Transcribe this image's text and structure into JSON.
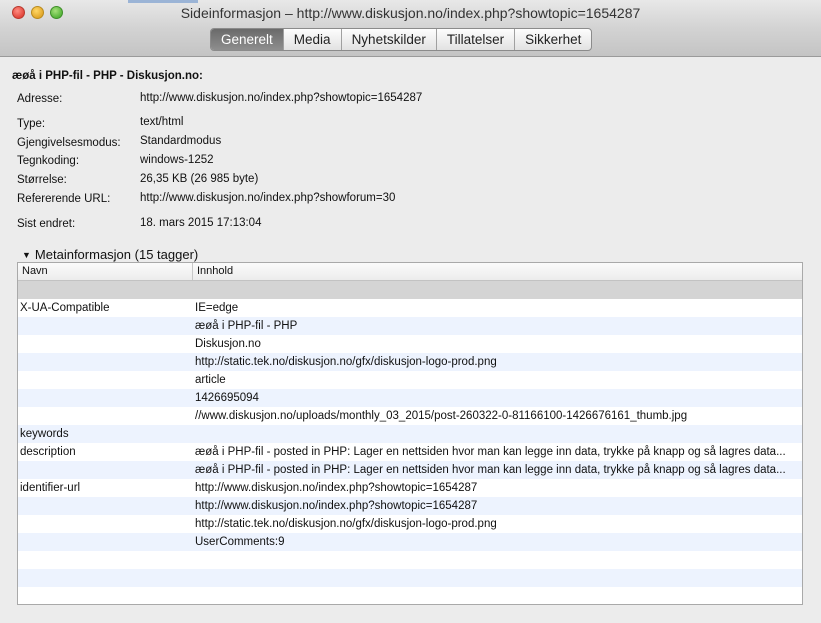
{
  "window": {
    "title": "Sideinformasjon – http://www.diskusjon.no/index.php?showtopic=1654287",
    "tabs": [
      {
        "label": "Generelt",
        "active": true
      },
      {
        "label": "Media",
        "active": false
      },
      {
        "label": "Nyhetskilder",
        "active": false
      },
      {
        "label": "Tillatelser",
        "active": false
      },
      {
        "label": "Sikkerhet",
        "active": false
      }
    ]
  },
  "general": {
    "page_title": "æøå i PHP-fil - PHP - Diskusjon.no:",
    "fields": [
      {
        "label": "Adresse:",
        "value": "http://www.diskusjon.no/index.php?showtopic=1654287"
      },
      {
        "label": "Type:",
        "value": "text/html"
      },
      {
        "label": "Gjengivelsesmodus:",
        "value": "Standardmodus"
      },
      {
        "label": "Tegnkoding:",
        "value": "windows-1252"
      },
      {
        "label": "Størrelse:",
        "value": "26,35 KB (26 985 byte)"
      },
      {
        "label": "Refererende URL:",
        "value": "http://www.diskusjon.no/index.php?showforum=30"
      },
      {
        "label": "Sist endret:",
        "value": "18. mars 2015 17:13:04"
      }
    ]
  },
  "meta": {
    "section_label": "Metainformasjon (15 tagger)",
    "columns": [
      "Navn",
      "Innhold"
    ],
    "rows": [
      {
        "name": "",
        "content": ""
      },
      {
        "name": "X-UA-Compatible",
        "content": "IE=edge"
      },
      {
        "name": "",
        "content": "æøå i PHP-fil - PHP"
      },
      {
        "name": "",
        "content": "Diskusjon.no"
      },
      {
        "name": "",
        "content": "http://static.tek.no/diskusjon.no/gfx/diskusjon-logo-prod.png"
      },
      {
        "name": "",
        "content": "article"
      },
      {
        "name": "",
        "content": "1426695094"
      },
      {
        "name": "",
        "content": "//www.diskusjon.no/uploads/monthly_03_2015/post-260322-0-81166100-1426676161_thumb.jpg"
      },
      {
        "name": "keywords",
        "content": ""
      },
      {
        "name": "description",
        "content": "æøå i PHP-fil - posted in PHP: Lager en nettsiden hvor man kan legge inn data, trykke på knapp og så lagres data..."
      },
      {
        "name": "",
        "content": "æøå i PHP-fil - posted in PHP: Lager en nettsiden hvor man kan legge inn data, trykke på knapp og så lagres data..."
      },
      {
        "name": "identifier-url",
        "content": "http://www.diskusjon.no/index.php?showtopic=1654287"
      },
      {
        "name": "",
        "content": "http://www.diskusjon.no/index.php?showtopic=1654287"
      },
      {
        "name": "",
        "content": "http://static.tek.no/diskusjon.no/gfx/diskusjon-logo-prod.png"
      },
      {
        "name": "",
        "content": "UserComments:9"
      }
    ]
  }
}
